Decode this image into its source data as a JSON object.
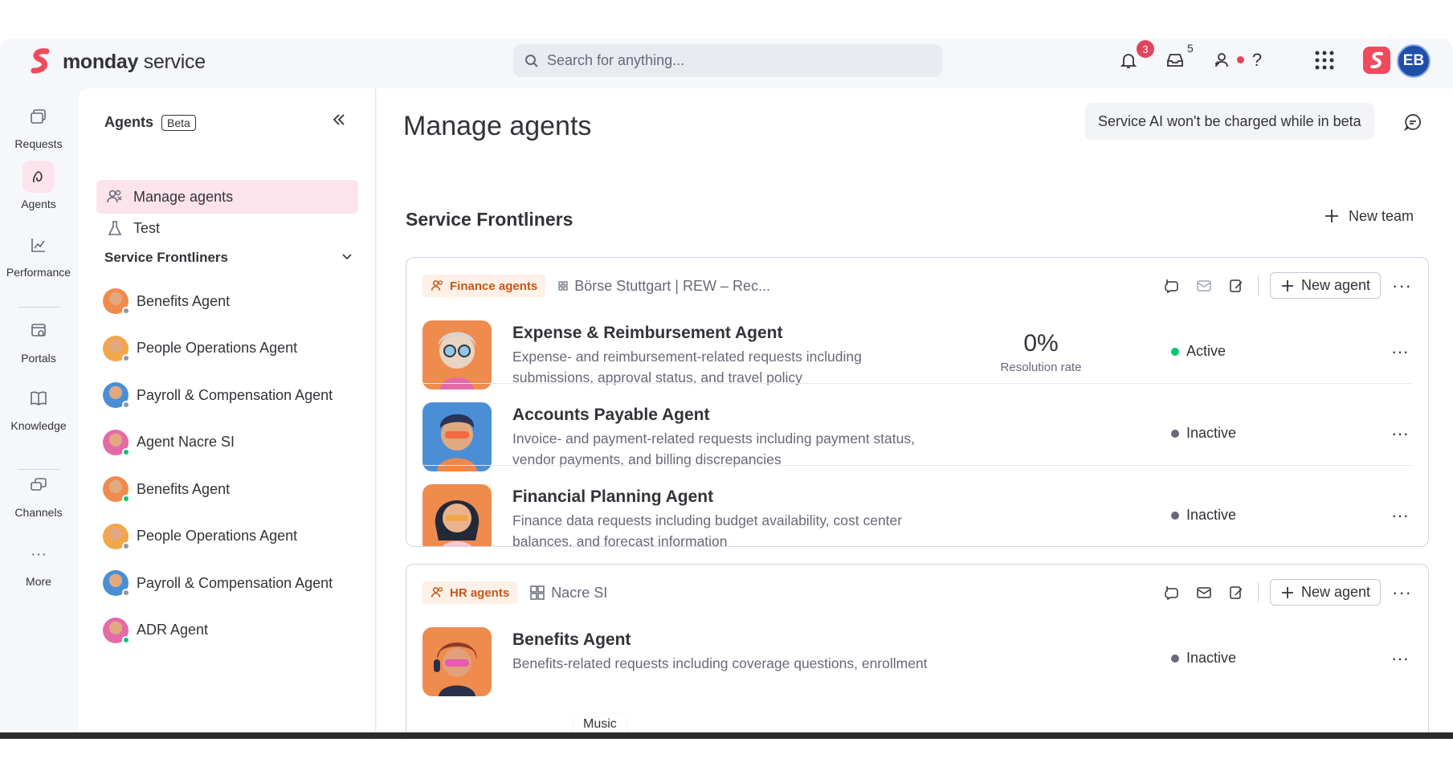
{
  "topbar": {
    "brand_bold": "monday",
    "brand_light": " service",
    "search_placeholder": "Search for anything...",
    "notifications_count": "3",
    "inbox_count": "5",
    "help_icon": "?",
    "avatar_initials": "EB"
  },
  "rail": [
    {
      "label": "Requests",
      "icon": "requests-icon"
    },
    {
      "label": "Agents",
      "icon": "agents-icon"
    },
    {
      "label": "Performance",
      "icon": "performance-icon"
    },
    {
      "label": "Portals",
      "icon": "portals-icon"
    },
    {
      "label": "Knowledge",
      "icon": "knowledge-icon"
    },
    {
      "label": "Channels",
      "icon": "channels-icon"
    },
    {
      "label": "More",
      "icon": "more-icon"
    }
  ],
  "panel": {
    "title": "Agents",
    "badge": "Beta",
    "nav": [
      {
        "label": "Manage agents"
      },
      {
        "label": "Test"
      }
    ],
    "group_title": "Service Frontliners",
    "agents": [
      {
        "label": "Benefits Agent",
        "status_color": "#8f96a8"
      },
      {
        "label": "People Operations Agent",
        "status_color": "#8f96a8"
      },
      {
        "label": "Payroll & Compensation Agent",
        "status_color": "#8f96a8"
      },
      {
        "label": "Agent Nacre SI",
        "status_color": "#00c875"
      },
      {
        "label": "Benefits Agent",
        "status_color": "#00c875"
      },
      {
        "label": "People Operations Agent",
        "status_color": "#8f96a8"
      },
      {
        "label": "Payroll & Compensation Agent",
        "status_color": "#8f96a8"
      },
      {
        "label": "ADR Agent",
        "status_color": "#00c875"
      }
    ]
  },
  "main": {
    "title": "Manage agents",
    "beta_note": "Service AI won't be charged while in beta",
    "team_title": "Service Frontliners",
    "new_team_label": "New team",
    "teams": [
      {
        "tag": "Finance agents",
        "source": "Börse Stuttgart | REW – Rec...",
        "new_agent_label": "New agent",
        "agents": [
          {
            "name": "Expense & Reimbursement Agent",
            "desc": "Expense- and reimbursement-related requests including submissions, approval status, and travel policy",
            "rate": "0%",
            "rate_label": "Resolution rate",
            "status": "Active",
            "status_color": "#00c875"
          },
          {
            "name": "Accounts Payable Agent",
            "desc": "Invoice- and payment-related requests including payment status, vendor payments, and billing discrepancies",
            "status": "Inactive",
            "status_color": "#676879"
          },
          {
            "name": "Financial Planning Agent",
            "desc": "Finance data requests including budget availability, cost center balances, and forecast information",
            "status": "Inactive",
            "status_color": "#676879"
          }
        ]
      },
      {
        "tag": "HR agents",
        "source": "Nacre SI",
        "new_agent_label": "New agent",
        "agents": [
          {
            "name": "Benefits Agent",
            "desc": "Benefits-related requests including coverage questions, enrollment",
            "status": "Inactive",
            "status_color": "#676879"
          }
        ]
      }
    ]
  },
  "overlay": {
    "music_label": "Music"
  }
}
